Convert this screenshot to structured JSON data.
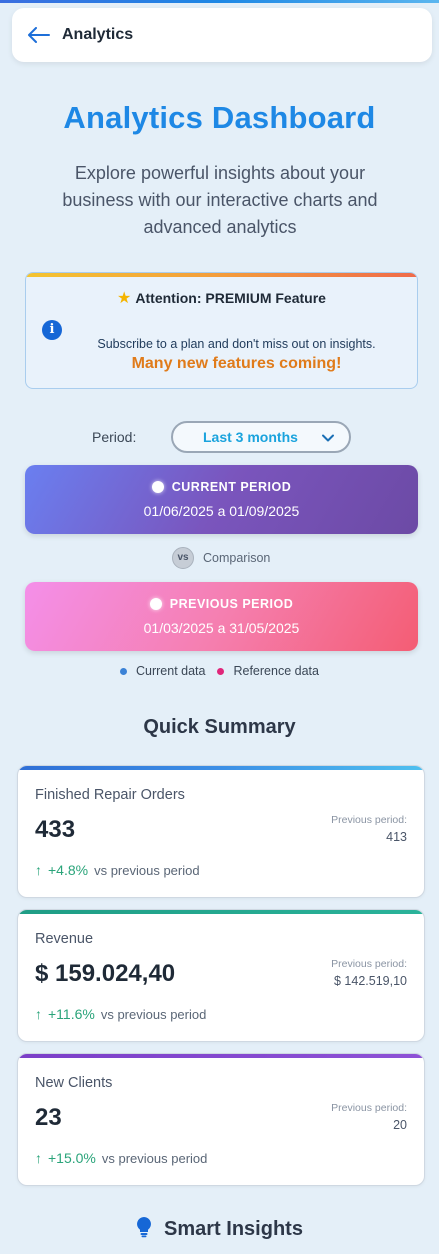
{
  "app_bar": {
    "title": "Analytics"
  },
  "hero": {
    "title": "Analytics Dashboard",
    "subtitle": "Explore powerful insights about your business with our interactive charts and advanced analytics"
  },
  "premium": {
    "heading": "Attention: PREMIUM Feature",
    "message": "Subscribe to a plan and don't miss out on insights.",
    "coming": "Many new features coming!"
  },
  "period": {
    "label": "Period:",
    "selected": "Last 3 months"
  },
  "current_period": {
    "label": "CURRENT PERIOD",
    "dates": "01/06/2025 a 01/09/2025"
  },
  "comparison": {
    "badge": "vs",
    "label": "Comparison"
  },
  "previous_period": {
    "label": "PREVIOUS PERIOD",
    "dates": "01/03/2025 a 31/05/2025"
  },
  "legend": {
    "current": "Current data",
    "reference": "Reference data",
    "current_color": "#3b82d6",
    "reference_color": "#e0267a"
  },
  "summary": {
    "title": "Quick Summary",
    "metrics": [
      {
        "label": "Finished Repair Orders",
        "value": "433",
        "prev_label": "Previous period:",
        "prev_value": "413",
        "change": "+4.8%",
        "vs": "vs previous period",
        "accent": "#2f6fd6"
      },
      {
        "label": "Revenue",
        "value": "$ 159.024,40",
        "prev_label": "Previous period:",
        "prev_value": "$ 142.519,10",
        "change": "+11.6%",
        "vs": "vs previous period",
        "accent": "#1f9d85"
      },
      {
        "label": "New Clients",
        "value": "23",
        "prev_label": "Previous period:",
        "prev_value": "20",
        "change": "+15.0%",
        "vs": "vs previous period",
        "accent": "#7b3fc8"
      }
    ]
  },
  "insights": {
    "title": "Smart Insights"
  }
}
